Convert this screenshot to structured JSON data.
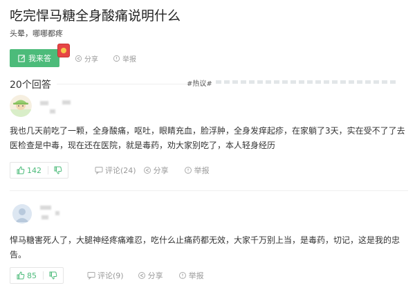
{
  "question": {
    "title": "吃完悍马糖全身酸痛说明什么",
    "description": "头晕，哪哪都疼",
    "answer_button": "我来答",
    "share": "分享",
    "report": "举报"
  },
  "answers_header": {
    "count": "20个回答",
    "hot_tag": "#热议#"
  },
  "answers": [
    {
      "text": "我也几天前吃了一颗，全身酸痛，呕吐，眼睛充血，脸浮肿，全身发痒起疹，在家躺了3天，实在受不了了去医检查是中毒，现在还在医院，就是毒药，劝大家别吃了，本人轻身经历",
      "likes": "142",
      "comments": "评论(24)",
      "share": "分享",
      "report": "举报"
    },
    {
      "text": "悍马糖害死人了，大腿神经疼痛难忍，吃什么止痛药都无效，大家千万别上当，是毒药，切记，这是我的忠告。",
      "likes": "85",
      "comments": "评论(9)",
      "share": "分享",
      "report": "举报"
    }
  ],
  "colors": {
    "accent": "#4cbb7a",
    "muted": "#999999",
    "text": "#333333"
  },
  "icons": [
    "edit-icon",
    "share-icon",
    "report-icon",
    "thumbs-up-icon",
    "thumbs-down-icon",
    "comment-icon"
  ]
}
